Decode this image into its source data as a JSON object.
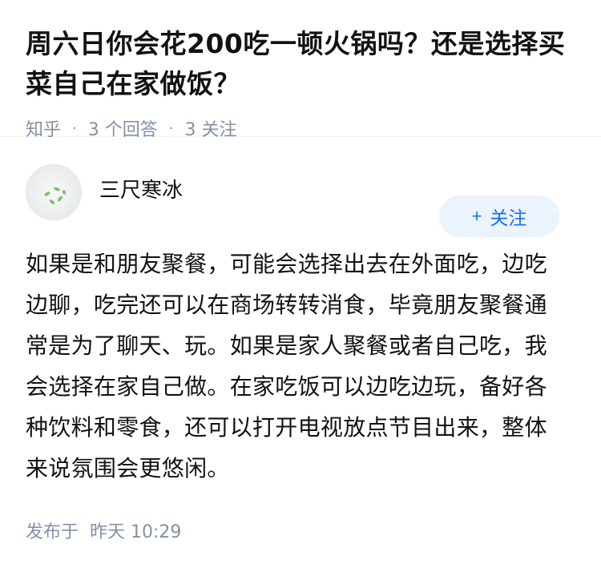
{
  "question": {
    "title": "周六日你会花200吃一顿火锅吗？还是选择买菜自己在家做饭？",
    "source": "知乎",
    "answer_count": "3 个回答",
    "follow_count": "3 关注",
    "separator": "·"
  },
  "answer": {
    "author_name": "三尺寒冰",
    "follow_label": "关注",
    "follow_plus": "+",
    "content": "如果是和朋友聚餐，可能会选择出去在外面吃，边吃边聊，吃完还可以在商场转转消食，毕竟朋友聚餐通常是为了聊天、玩。如果是家人聚餐或者自己吃，我会选择在家自己做。在家吃饭可以边吃边玩，备好各种饮料和零食，还可以打开电视放点节目出来，整体来说氛围会更悠闲。",
    "published_label": "发布于",
    "published_time": "昨天 10:29"
  },
  "colors": {
    "accent": "#1772f6",
    "meta_gray": "#8590a6",
    "follow_bg": "#ebf3fc"
  }
}
